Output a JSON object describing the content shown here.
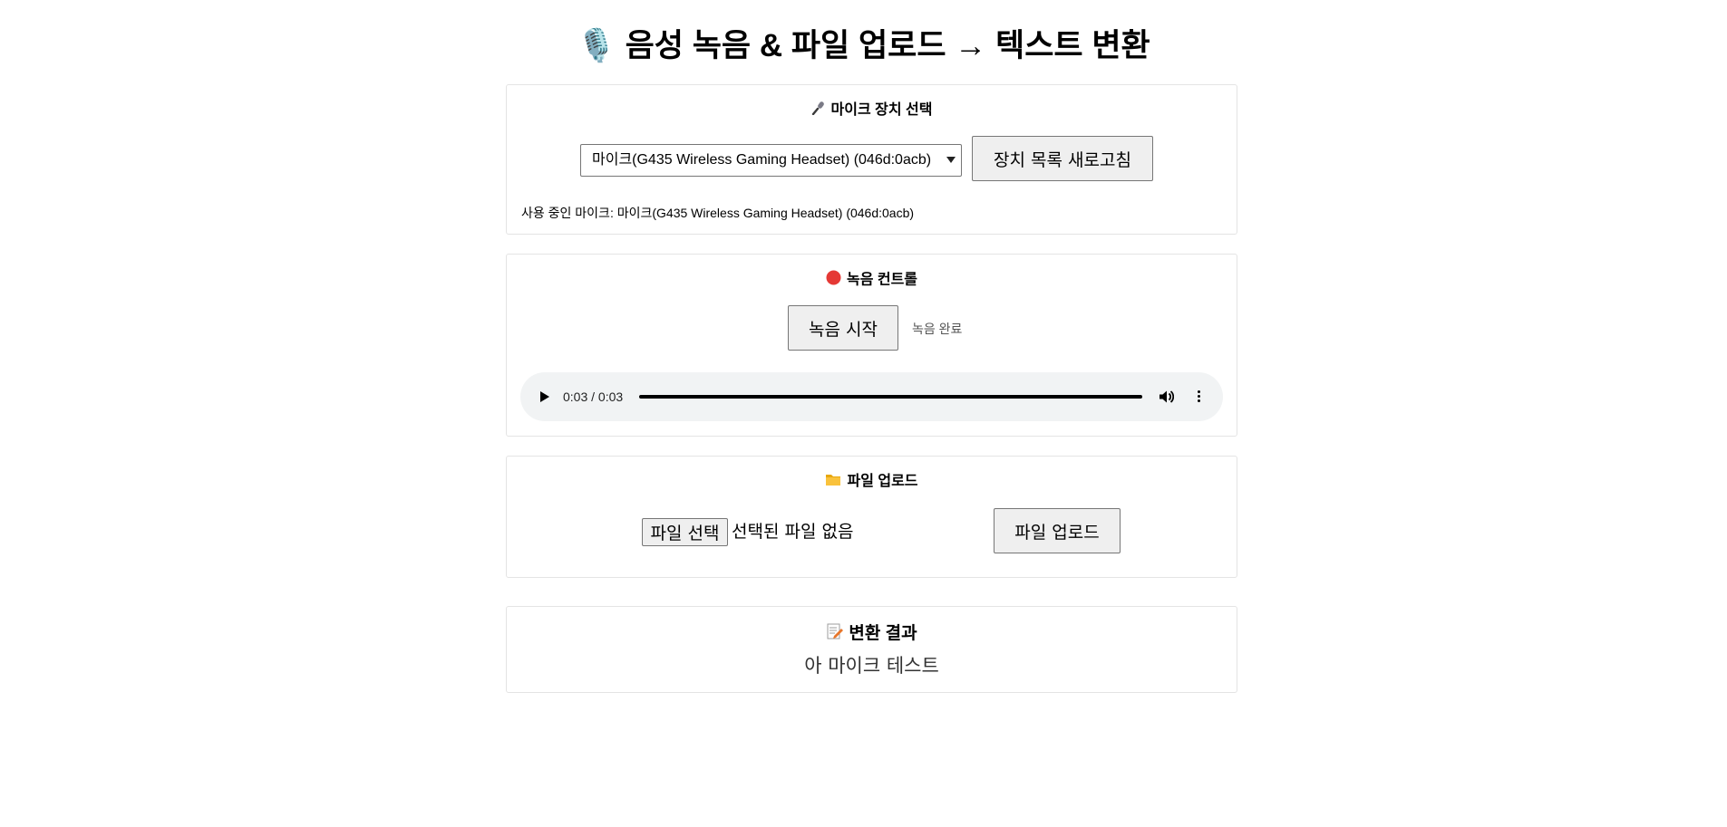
{
  "page": {
    "title": "🎙️ 음성 녹음 & 파일 업로드 → 텍스트 변환"
  },
  "mic_section": {
    "title": "마이크 장치 선택",
    "icon": "microphone-icon",
    "selected_device": "마이크(G435 Wireless Gaming Headset) (046d:0acb)",
    "refresh_label": "장치 목록 새로고침",
    "active_label": "사용 중인 마이크: 마이크(G435 Wireless Gaming Headset) (046d:0acb)"
  },
  "record_section": {
    "title": "녹음 컨트롤",
    "icon": "red-circle-icon",
    "start_label": "녹음 시작",
    "status": "녹음 완료",
    "audio_time": "0:03 / 0:03"
  },
  "upload_section": {
    "title": "파일 업로드",
    "icon": "folder-icon",
    "choose_label": "파일 선택",
    "file_status": "선택된 파일 없음",
    "upload_label": "파일 업로드"
  },
  "result_section": {
    "title": "변환 결과",
    "icon": "memo-icon",
    "text": "아 마이크 테스트"
  },
  "colors": {
    "record_dot": "#e53935",
    "folder": "#f9c23c",
    "audio_bg": "#f1f3f4"
  }
}
